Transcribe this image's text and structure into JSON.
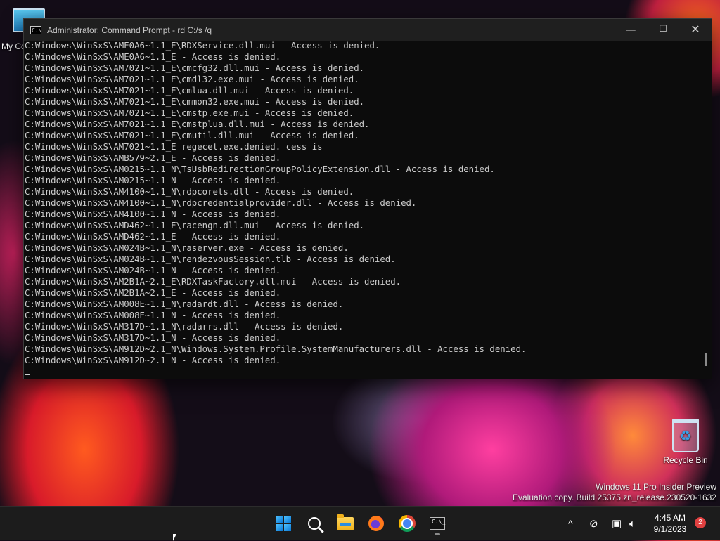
{
  "desktop": {
    "my_computer_label": "My Co",
    "recycle_bin_label": "Recycle Bin"
  },
  "window": {
    "title": "Administrator:  Command Prompt - rd  C:/s /q",
    "minimize_glyph": "—",
    "maximize_glyph": "☐",
    "close_glyph": "✕"
  },
  "console": {
    "lines": [
      "C:Windows\\WinSxS\\AME0A6~1.1_E\\RDXService.dll.mui - Access is denied.",
      "C:Windows\\WinSxS\\AME0A6~1.1_E - Access is denied.",
      "C:Windows\\WinSxS\\AM7021~1.1_E\\cmcfg32.dll.mui - Access is denied.",
      "C:Windows\\WinSxS\\AM7021~1.1_E\\cmdl32.exe.mui - Access is denied.",
      "C:Windows\\WinSxS\\AM7021~1.1_E\\cmlua.dll.mui - Access is denied.",
      "C:Windows\\WinSxS\\AM7021~1.1_E\\cmmon32.exe.mui - Access is denied.",
      "C:Windows\\WinSxS\\AM7021~1.1_E\\cmstp.exe.mui - Access is denied.",
      "C:Windows\\WinSxS\\AM7021~1.1_E\\cmstplua.dll.mui - Access is denied.",
      "C:Windows\\WinSxS\\AM7021~1.1_E\\cmutil.dll.mui - Access is denied.",
      "C:Windows\\WinSxS\\AM7021~1.1_E regecet.exe.denied. cess is",
      "C:Windows\\WinSxS\\AMB579~2.1_E - Access is denied.",
      "C:Windows\\WinSxS\\AM0215~1.1_N\\TsUsbRedirectionGroupPolicyExtension.dll - Access is denied.",
      "C:Windows\\WinSxS\\AM0215~1.1_N - Access is denied.",
      "C:Windows\\WinSxS\\AM4100~1.1_N\\rdpcorets.dll - Access is denied.",
      "C:Windows\\WinSxS\\AM4100~1.1_N\\rdpcredentialprovider.dll - Access is denied.",
      "C:Windows\\WinSxS\\AM4100~1.1_N - Access is denied.",
      "C:Windows\\WinSxS\\AMD462~1.1_E\\racengn.dll.mui - Access is denied.",
      "C:Windows\\WinSxS\\AMD462~1.1_E - Access is denied.",
      "C:Windows\\WinSxS\\AM024B~1.1_N\\raserver.exe - Access is denied.",
      "C:Windows\\WinSxS\\AM024B~1.1_N\\rendezvousSession.tlb - Access is denied.",
      "C:Windows\\WinSxS\\AM024B~1.1_N - Access is denied.",
      "C:Windows\\WinSxS\\AM2B1A~2.1_E\\RDXTaskFactory.dll.mui - Access is denied.",
      "C:Windows\\WinSxS\\AM2B1A~2.1_E - Access is denied.",
      "C:Windows\\WinSxS\\AM008E~1.1_N\\radardt.dll - Access is denied.",
      "C:Windows\\WinSxS\\AM008E~1.1_N - Access is denied.",
      "C:Windows\\WinSxS\\AM317D~1.1_N\\radarrs.dll - Access is denied.",
      "C:Windows\\WinSxS\\AM317D~1.1_N - Access is denied.",
      "C:Windows\\WinSxS\\AM912D~2.1_N\\Windows.System.Profile.SystemManufacturers.dll - Access is denied.",
      "C:Windows\\WinSxS\\AM912D~2.1_N - Access is denied."
    ]
  },
  "watermark": {
    "line1": "Windows 11 Pro Insider Preview",
    "line2": "Evaluation copy. Build 25375.zn_release.230520-1632"
  },
  "taskbar": {
    "terminal_icon_text": "C:\\_",
    "tray_chevron": "^",
    "clock_time": "4:45 AM",
    "clock_date": "9/1/2023",
    "notification_count": "2"
  },
  "colors": {
    "console_bg": "#0c0c0c",
    "console_text": "#cccccc",
    "titlebar_bg": "#1f1f1f",
    "taskbar_bg": "#1c1c1c",
    "badge": "#e04040"
  }
}
